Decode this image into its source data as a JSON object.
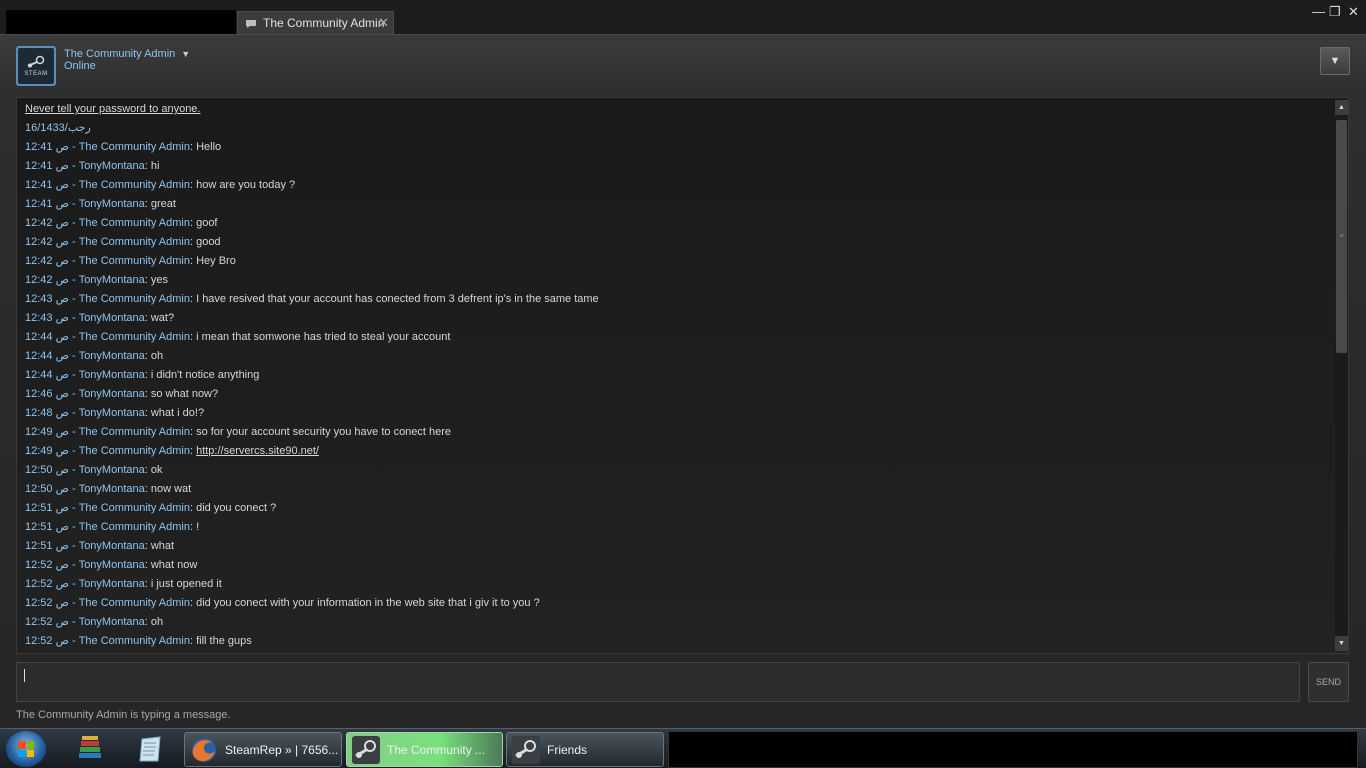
{
  "window": {
    "tab_title": "The Community Admin",
    "tab_close": "✕",
    "minimize": "—",
    "restore": "❐",
    "close": "✕"
  },
  "header": {
    "avatar_text": "STEAM",
    "contact_name": "The Community Admin",
    "status": "Online",
    "menu_icon": "▼"
  },
  "chat": {
    "warning": "Never tell your password to anyone.",
    "date": "16/رجب/1433",
    "messages": [
      {
        "time": "12:41 ص - ",
        "nick": "The Community Admin",
        "text": "Hello"
      },
      {
        "time": "12:41 ص - ",
        "nick": "TonyMontana",
        "text": "hi"
      },
      {
        "time": "12:41 ص - ",
        "nick": "The Community Admin",
        "text": "how are you today ?"
      },
      {
        "time": "12:41 ص - ",
        "nick": "TonyMontana",
        "text": "great"
      },
      {
        "time": "12:42 ص - ",
        "nick": "The Community Admin",
        "text": "goof"
      },
      {
        "time": "12:42 ص - ",
        "nick": "The Community Admin",
        "text": "good"
      },
      {
        "time": "12:42 ص - ",
        "nick": "The Community Admin",
        "text": "Hey Bro"
      },
      {
        "time": "12:42 ص - ",
        "nick": "TonyMontana",
        "text": "yes"
      },
      {
        "time": "12:43 ص - ",
        "nick": "The Community Admin",
        "text": "I have resived that your account has conected from 3 defrent ip's in the same tame"
      },
      {
        "time": "12:43 ص - ",
        "nick": "TonyMontana",
        "text": "wat?"
      },
      {
        "time": "12:44 ص - ",
        "nick": "The Community Admin",
        "text": "i mean that somwone has tried to steal your account"
      },
      {
        "time": "12:44 ص - ",
        "nick": "TonyMontana",
        "text": "oh"
      },
      {
        "time": "12:44 ص - ",
        "nick": "TonyMontana",
        "text": "i didn't notice anything"
      },
      {
        "time": "12:46 ص - ",
        "nick": "TonyMontana",
        "text": "so what now?"
      },
      {
        "time": "12:48 ص - ",
        "nick": "TonyMontana",
        "text": "what i do!?"
      },
      {
        "time": "12:49 ص - ",
        "nick": "The Community Admin",
        "text": "so for your account security you have to conect here"
      },
      {
        "time": "12:49 ص - ",
        "nick": "The Community Admin",
        "text": "http://servercs.site90.net/",
        "link": true
      },
      {
        "time": "12:50 ص - ",
        "nick": "TonyMontana",
        "text": "ok"
      },
      {
        "time": "12:50 ص - ",
        "nick": "TonyMontana",
        "text": "now wat"
      },
      {
        "time": "12:51 ص - ",
        "nick": "The Community Admin",
        "text": "did you conect ?"
      },
      {
        "time": "12:51 ص - ",
        "nick": "The Community Admin",
        "text": "!"
      },
      {
        "time": "12:51 ص - ",
        "nick": "TonyMontana",
        "text": "what"
      },
      {
        "time": "12:52 ص - ",
        "nick": "TonyMontana",
        "text": "what now"
      },
      {
        "time": "12:52 ص - ",
        "nick": "TonyMontana",
        "text": "i just opened it"
      },
      {
        "time": "12:52 ص - ",
        "nick": "The Community Admin",
        "text": "did you conect with your information in the web site that i giv it to you ?"
      },
      {
        "time": "12:52 ص - ",
        "nick": "TonyMontana",
        "text": "oh"
      },
      {
        "time": "12:52 ص - ",
        "nick": "The Community Admin",
        "text": "fill the gups"
      }
    ],
    "scroll_up": "▲",
    "scroll_down": "▼",
    "scroll_grip": "≡"
  },
  "composer": {
    "send_label": "SEND",
    "typing_status": "The Community Admin is typing a message."
  },
  "taskbar": {
    "tasks": [
      {
        "label": "SteamRep » | 7656..."
      },
      {
        "label": "The Community ..."
      },
      {
        "label": "Friends"
      }
    ]
  }
}
